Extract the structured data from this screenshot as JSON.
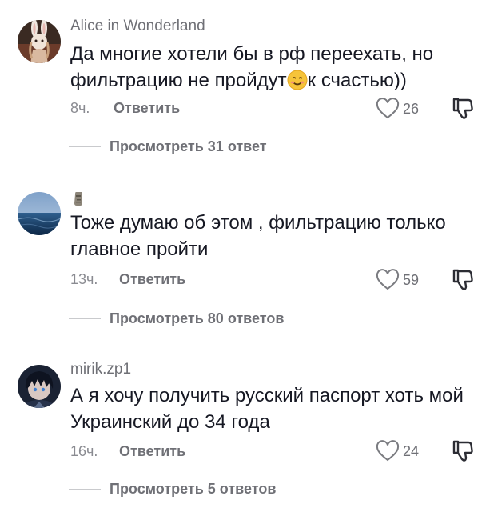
{
  "colors": {
    "text": "#161823",
    "muted": "#6f7076",
    "like_icon": "#7a7b80",
    "background": "#ffffff"
  },
  "comments": [
    {
      "avatar_icon": "avatar-girl-with-bunny-ears-icon",
      "username": "Alice in Wonderland",
      "text_part1": "Да многие хотели бы в рф переехать, но фильтрацию не пройдут",
      "inline_emoji_icon": "smiling-face-emoji-icon",
      "text_part2": "к счастью))",
      "time": "8ч.",
      "reply_label": "Ответить",
      "likes": "26",
      "view_replies_label": "Просмотреть 31 ответ"
    },
    {
      "avatar_icon": "avatar-sea-icon",
      "username_icon": "moai-emoji-icon",
      "text": "Тоже думаю об этом , фильтрацию только главное пройти",
      "time": "13ч.",
      "reply_label": "Ответить",
      "likes": "59",
      "view_replies_label": "Просмотреть 80 ответов"
    },
    {
      "avatar_icon": "avatar-anime-character-icon",
      "username": "mirik.zp1",
      "text": "А я хочу получить русский паспорт хоть мой Украинский до 34 года",
      "time": "16ч.",
      "reply_label": "Ответить",
      "likes": "24",
      "view_replies_label": "Просмотреть 5 ответов"
    }
  ]
}
